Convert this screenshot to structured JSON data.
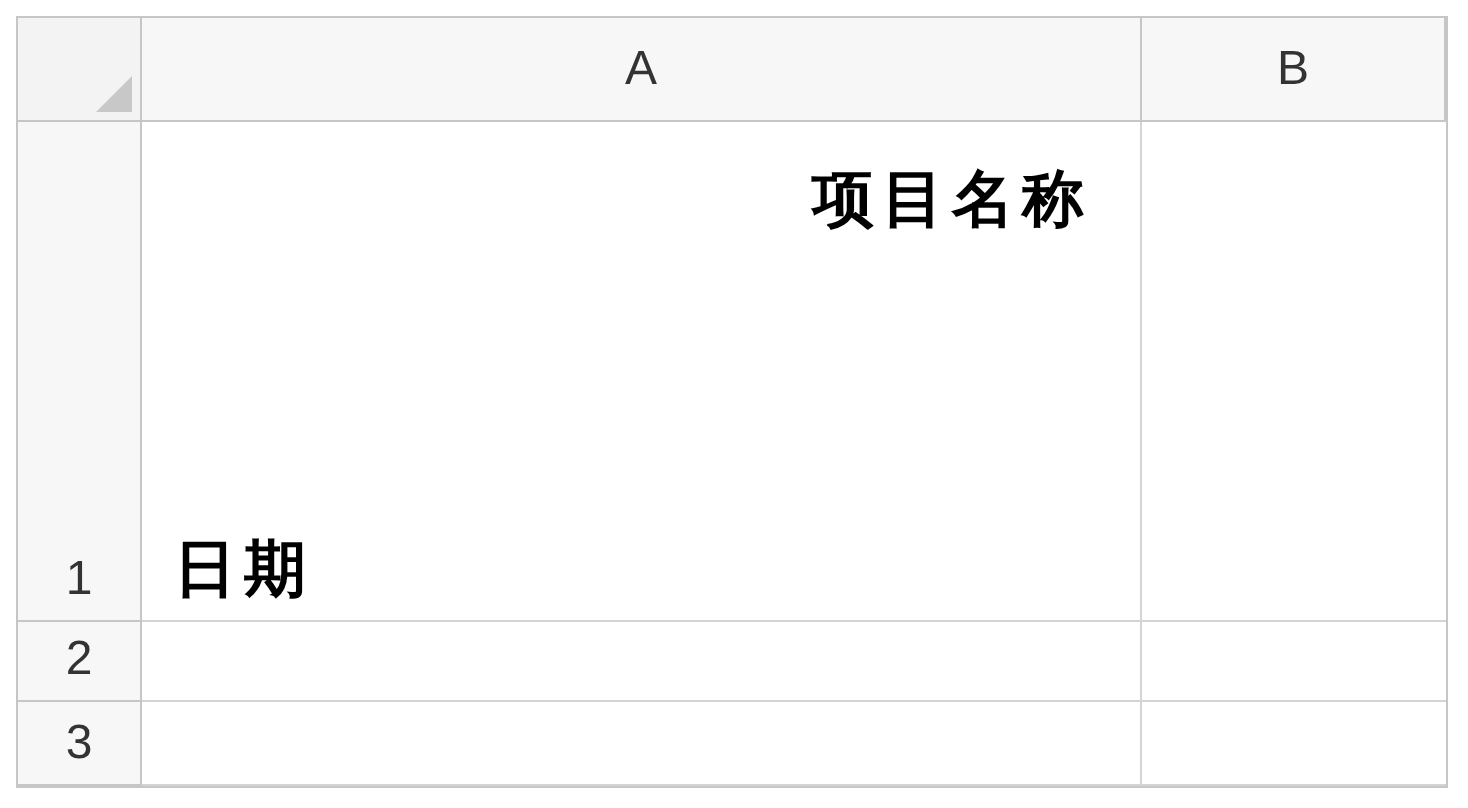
{
  "columns": [
    {
      "label": "A"
    },
    {
      "label": "B"
    }
  ],
  "rows": [
    {
      "number": "1",
      "cell_a": {
        "top_text": "项目名称",
        "bottom_text": "日期"
      }
    },
    {
      "number": "2"
    },
    {
      "number": "3"
    }
  ]
}
